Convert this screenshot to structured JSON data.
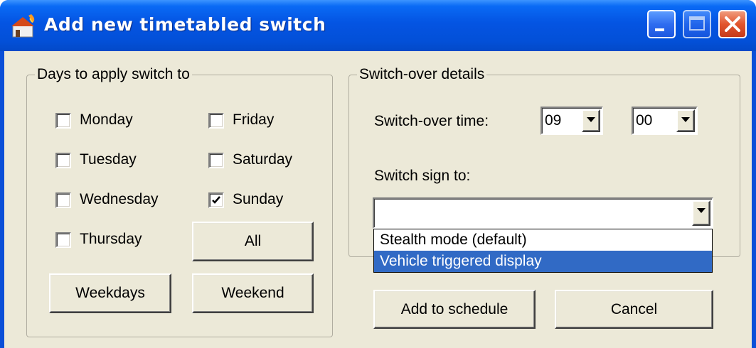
{
  "window": {
    "title": "Add new timetabled switch"
  },
  "days_group": {
    "label": "Days to apply switch to",
    "days": {
      "monday": {
        "label": "Monday",
        "checked": false
      },
      "tuesday": {
        "label": "Tuesday",
        "checked": false
      },
      "wednesday": {
        "label": "Wednesday",
        "checked": false
      },
      "thursday": {
        "label": "Thursday",
        "checked": false
      },
      "friday": {
        "label": "Friday",
        "checked": false
      },
      "saturday": {
        "label": "Saturday",
        "checked": false
      },
      "sunday": {
        "label": "Sunday",
        "checked": true
      }
    },
    "all_button": "All",
    "weekdays_button": "Weekdays",
    "weekend_button": "Weekend"
  },
  "details_group": {
    "label": "Switch-over details",
    "time_label": "Switch-over time:",
    "hour_value": "09",
    "minute_value": "00",
    "sign_label": "Switch sign to:",
    "sign_value": "",
    "sign_options": [
      "Stealth mode (default)",
      "Vehicle triggered display"
    ],
    "sign_highlighted": "Vehicle triggered display"
  },
  "buttons": {
    "add": "Add to schedule",
    "cancel": "Cancel"
  },
  "colors": {
    "titlebar": "#0454e2",
    "dialog_bg": "#ece9d8",
    "selection": "#316ac5",
    "close_button": "#e2552e"
  }
}
